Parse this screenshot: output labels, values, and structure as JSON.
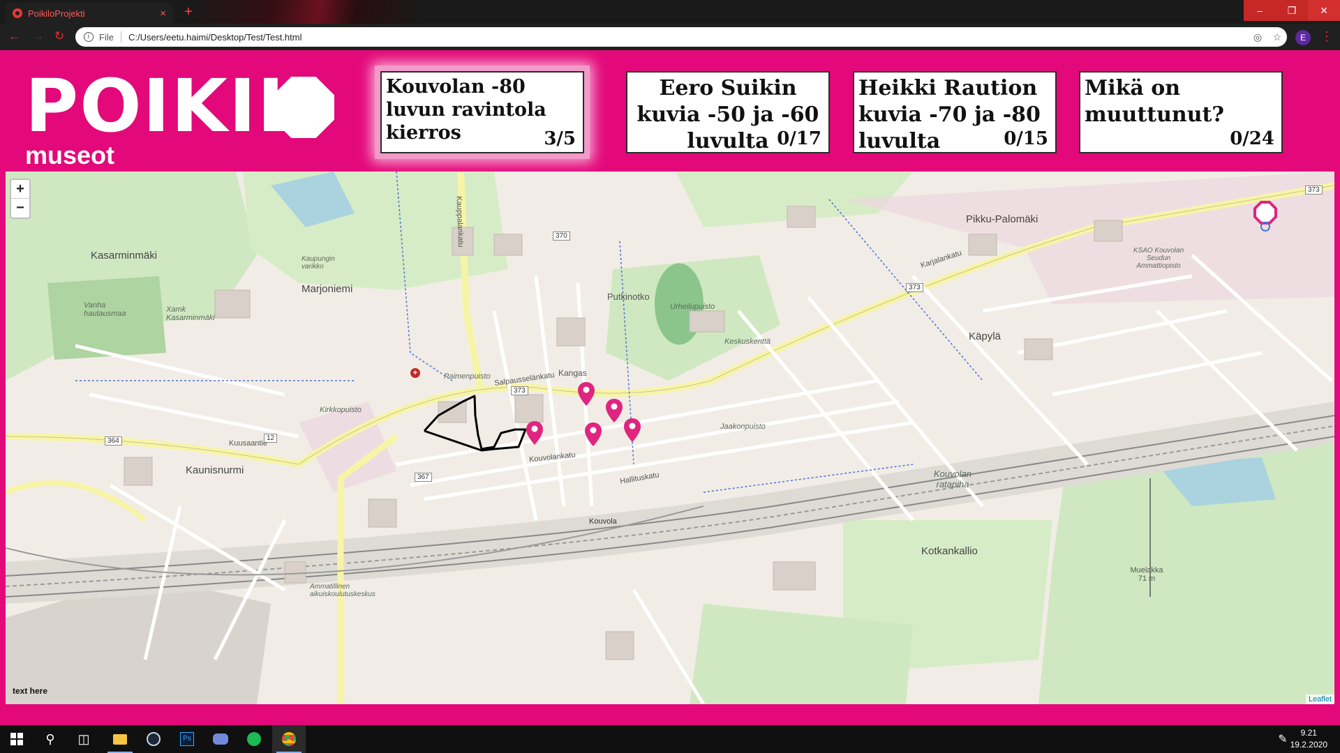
{
  "browser": {
    "tab_title": "PoikiloProjekti",
    "tab_close": "×",
    "new_tab": "+",
    "scheme_label": "File",
    "url": "C:/Users/eetu.haimi/Desktop/Test/Test.html",
    "profile_initial": "E",
    "window_min": "–",
    "window_max": "❐",
    "window_close": "✕"
  },
  "logo": {
    "word": "POIKIL",
    "sub": "museot"
  },
  "cards": [
    {
      "title": "Kouvolan -80 luvun ravintola kierros",
      "count": "3/5"
    },
    {
      "title": "Eero Suikin kuvia -50 ja -60 luvulta",
      "count": "0/17"
    },
    {
      "title": "Heikki Raution kuvia -70 ja -80 luvulta",
      "count": "0/15"
    },
    {
      "title": "Mikä on muuttunut?",
      "count": "0/24"
    }
  ],
  "map": {
    "zoom_in": "+",
    "zoom_out": "−",
    "attribution": "Leaflet",
    "note": "text here",
    "labels": {
      "kasarminmaki": "Kasarminmäki",
      "marjoniemi": "Marjoniemi",
      "vanha": "Vanha hautausmaa",
      "xamk": "Xamk Kasarminmäki",
      "kaupungin": "Kaupungin varikko",
      "putkinotko": "Putkinotko",
      "keskuskentta": "Keskuskenttä",
      "pikku": "Pikku-Palomäki",
      "kapyla": "Käpylä",
      "kangas": "Kangas",
      "kaunisnurmi": "Kaunisnurmi",
      "kouvola": "Kouvola",
      "ratapiha": "Kouvolan ratapiha",
      "kotkankallio": "Kotkankallio",
      "muelakka": "Muelakka 71 m",
      "ksao": "KSAO Kouvolan Seudun Ammattiopisto",
      "salpausselankatu": "Salpausselänkatu",
      "karjalankatu": "Karjalankatu",
      "kuusaantie": "Kuusaantie",
      "kouvolankatu": "Kouvolankatu",
      "hallituskatu": "Hallituskatu",
      "kauppalankatu": "Kauppalankatu",
      "kirkkopuisto": "Kirkkopuisto",
      "paimenpuisto": "Paimenpuisto",
      "ammatillinen": "Ammatillinen aikuiskoulutuskeskus",
      "irheilupuisto": "Urheilupuisto",
      "jaakonpuisto": "Jaakonpuisto"
    },
    "road_shields": [
      "370",
      "373",
      "364",
      "12",
      "367",
      "373",
      "373"
    ]
  },
  "taskbar": {
    "time": "9.21",
    "date": "19.2.2020"
  },
  "colors": {
    "brand": "#e3097a",
    "pin": "#e0247f",
    "route": "#000000"
  }
}
